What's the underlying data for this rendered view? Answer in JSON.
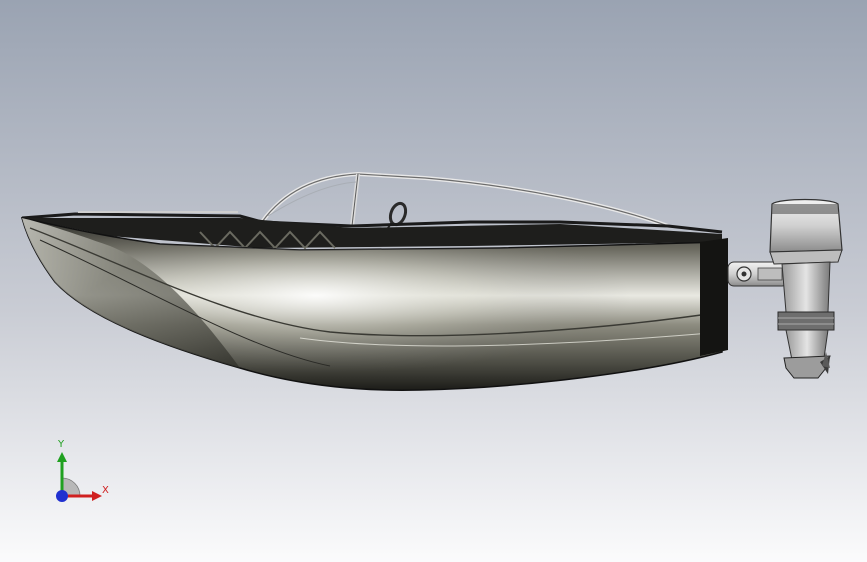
{
  "viewport": {
    "background_top": "#9aa3b2",
    "background_bottom": "#fbfbfc"
  },
  "model": {
    "icon": "speedboat-model",
    "hull_color": "#8a8a80",
    "engine_color": "#d8d8d8"
  },
  "triad": {
    "x_label": "X",
    "y_label": "Y",
    "x_color": "#d02020",
    "y_color": "#20a020",
    "z_color": "#2030d0"
  }
}
